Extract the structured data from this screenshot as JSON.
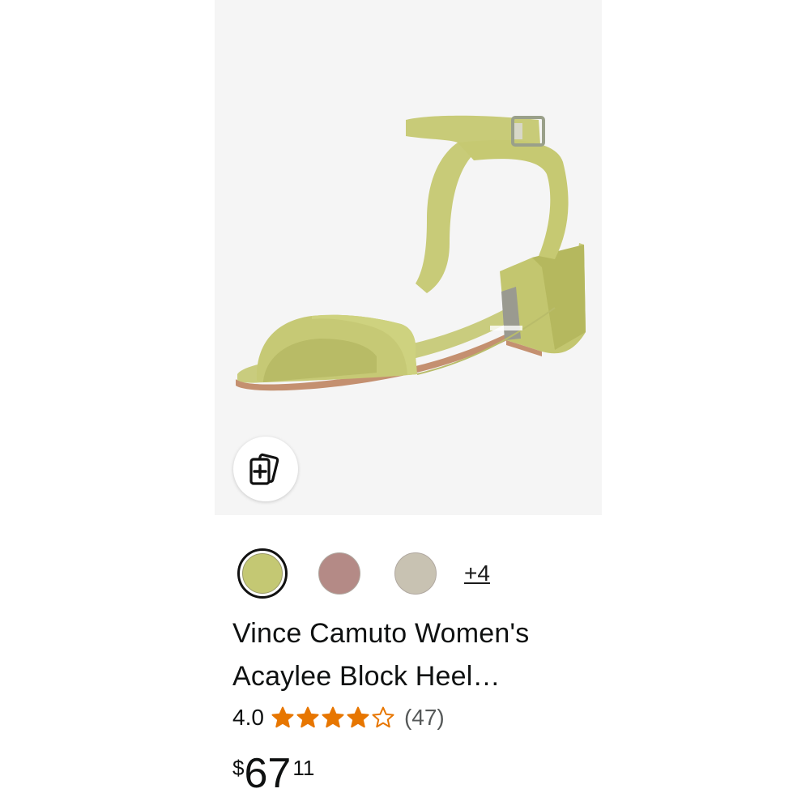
{
  "product": {
    "title_line1": "Vince Camuto Women's",
    "title_line2": "Acaylee Block Heel…",
    "rating_value": "4.0",
    "rating_stars": 4,
    "review_count": "(47)",
    "price_symbol": "$",
    "price_whole": "67",
    "price_fraction": "11"
  },
  "swatches": {
    "colors": [
      "#c4c873",
      "#b48a86",
      "#c8c2b2"
    ],
    "selected_index": 0,
    "more_label": "+4"
  },
  "icons": {
    "add_to_list": "add-to-collection-icon",
    "star_full": "star-full-icon",
    "star_empty": "star-empty-icon"
  },
  "colors": {
    "star": "#e77600",
    "image_background": "#f5f5f5"
  }
}
